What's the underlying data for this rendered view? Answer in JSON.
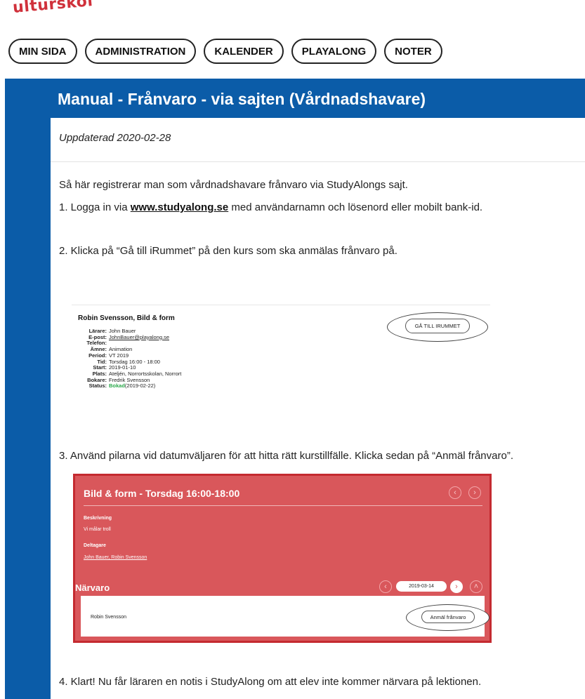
{
  "logo_text": "ulturskol",
  "nav": [
    "MIN SIDA",
    "ADMINISTRATION",
    "KALENDER",
    "PLAYALONG",
    "NOTER"
  ],
  "title": "Manual - Frånvaro - via sajten (Vårdnadshavare)",
  "updated": "Uppdaterad 2020-02-28",
  "intro": "Så här registrerar man som vårdnadshavare frånvaro via StudyAlongs sajt.",
  "step1_pre": "1. Logga in via ",
  "step1_link": "www.studyalong.se",
  "step1_post": " med användarnamn och lösenord eller mobilt bank-id.",
  "step2": "2. Klicka på “Gå till iRummet” på den kurs som ska anmälas frånvaro på.",
  "step3": "3. Använd pilarna vid datumväljaren för att hitta rätt kurstillfälle. Klicka sedan på “Anmäl frånvaro”.",
  "step4": "4. Klart! Nu får läraren en notis i StudyAlong om att elev inte kommer närvara på lektionen.",
  "card": {
    "title": "Robin Svensson, Bild & form",
    "button": "GÅ TILL IRUMMET",
    "rows": [
      {
        "k": "Lärare:",
        "v": "John Bauer"
      },
      {
        "k": "E-post:",
        "v": "JohnBauer@playalong.se"
      },
      {
        "k": "Telefon:",
        "v": ""
      },
      {
        "k": "Ämne:",
        "v": "Animation"
      },
      {
        "k": "Period:",
        "v": "VT 2019"
      },
      {
        "k": "Tid:",
        "v": "Torsdag 16:00 - 18:00"
      },
      {
        "k": "Start:",
        "v": "2019-01-10"
      },
      {
        "k": "Plats:",
        "v": "Ateljén, Norrortsskolan, Norrort"
      },
      {
        "k": "Bokare:",
        "v": "Fredrik Svensson"
      }
    ],
    "status_k": "Status:",
    "status_v": "Bokad",
    "status_date": " (2019-02-22)"
  },
  "red": {
    "title": "Bild & form - Torsdag 16:00-18:00",
    "beskrivning_label": "Beskrivning",
    "beskrivning": "Vi målar troll",
    "deltagare_label": "Deltagare",
    "deltagare": "John Bauer, Robin Svensson",
    "narvaro": "Närvaro",
    "date": "2019-03-14",
    "student": "Robin Svensson",
    "anmal": "Anmäl frånvaro"
  },
  "colors": {
    "header_blue": "#0b5ca8",
    "logo_red": "#d0313b",
    "red_panel": "#d9575b",
    "status_green": "#2aa84a"
  },
  "icons": [
    "chevron-left-icon",
    "chevron-right-icon",
    "chevron-up-icon"
  ]
}
